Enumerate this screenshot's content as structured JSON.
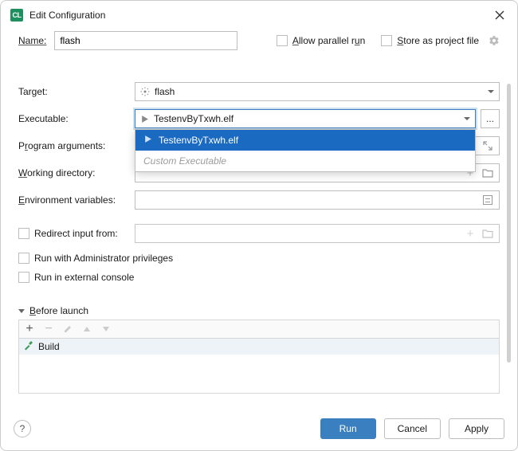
{
  "title": "Edit Configuration",
  "topRow": {
    "nameLabel": "Name:",
    "nameValue": "flash",
    "allowParallel": "Allow parallel run",
    "storeFile": "Store as project file"
  },
  "target": {
    "label": "Target:",
    "value": "flash"
  },
  "executable": {
    "label": "Executable:",
    "value": "TestenvByTxwh.elf",
    "options": [
      {
        "label": "TestenvByTxwh.elf",
        "kind": "exe"
      },
      {
        "label": "Custom Executable",
        "kind": "custom"
      }
    ],
    "browse": "..."
  },
  "programArgs": {
    "label": "Program arguments:"
  },
  "workingDir": {
    "label": "Working directory:"
  },
  "envVars": {
    "label": "Environment variables:"
  },
  "redirect": {
    "label": "Redirect input from:"
  },
  "adminPriv": "Run with Administrator privileges",
  "externalConsole": "Run in external console",
  "before": {
    "header": "Before launch",
    "task": "Build"
  },
  "buttons": {
    "run": "Run",
    "cancel": "Cancel",
    "apply": "Apply"
  }
}
